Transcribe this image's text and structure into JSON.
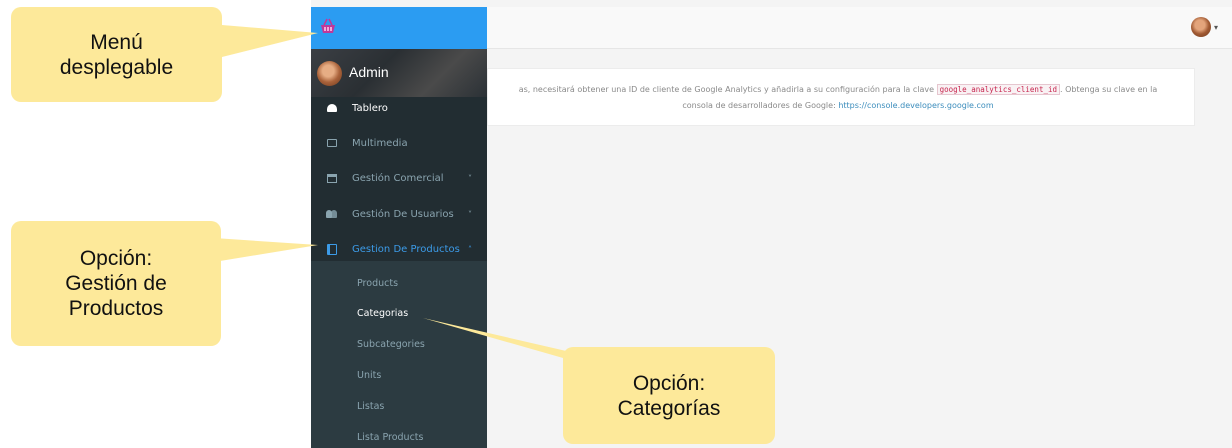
{
  "app": {
    "notice": {
      "text_before": "as, necesitará obtener una ID de cliente de Google Analytics y añadirla a su configuración para la clave",
      "code": "google_analytics_client_id",
      "text_after": ". Obtenga su clave en la",
      "line2_text": "consola de desarrolladores de Google:",
      "link": "https://console.developers.google.com"
    },
    "user_menu": {
      "avatar_icon": "user-avatar",
      "caret_icon": "caret-down-icon"
    }
  },
  "sidebar": {
    "logo_icon": "basket-logo-icon",
    "profile": {
      "name": "Admin",
      "avatar_icon": "user-avatar"
    },
    "menu": [
      {
        "label": "Tablero",
        "icon": "dashboard-icon",
        "active": true
      },
      {
        "label": "Multimedia",
        "icon": "media-icon"
      },
      {
        "label": "Gestión Comercial",
        "icon": "store-icon",
        "chevron": "˅"
      },
      {
        "label": "Gestión De Usuarios",
        "icon": "users-icon",
        "chevron": "˅"
      },
      {
        "label": "Gestion De Productos",
        "icon": "book-icon",
        "chevron": "˄",
        "open": true
      }
    ],
    "submenu": [
      {
        "label": "Products"
      },
      {
        "label": "Categorias",
        "selected": true
      },
      {
        "label": "Subcategories"
      },
      {
        "label": "Units"
      },
      {
        "label": "Listas"
      },
      {
        "label": "Lista Products"
      }
    ]
  },
  "callouts": {
    "menu": {
      "line1": "Menú",
      "line2": "desplegable"
    },
    "productos": {
      "line1": "Opción:",
      "line2": "Gestión de",
      "line3": "Productos"
    },
    "categorias": {
      "line1": "Opción:",
      "line2": "Categorías"
    }
  },
  "colors": {
    "sidebar_bg": "#222d32",
    "sidebar_header": "#2b9cf2",
    "accent": "#3c9be8",
    "callout_bg": "#fde99a"
  }
}
